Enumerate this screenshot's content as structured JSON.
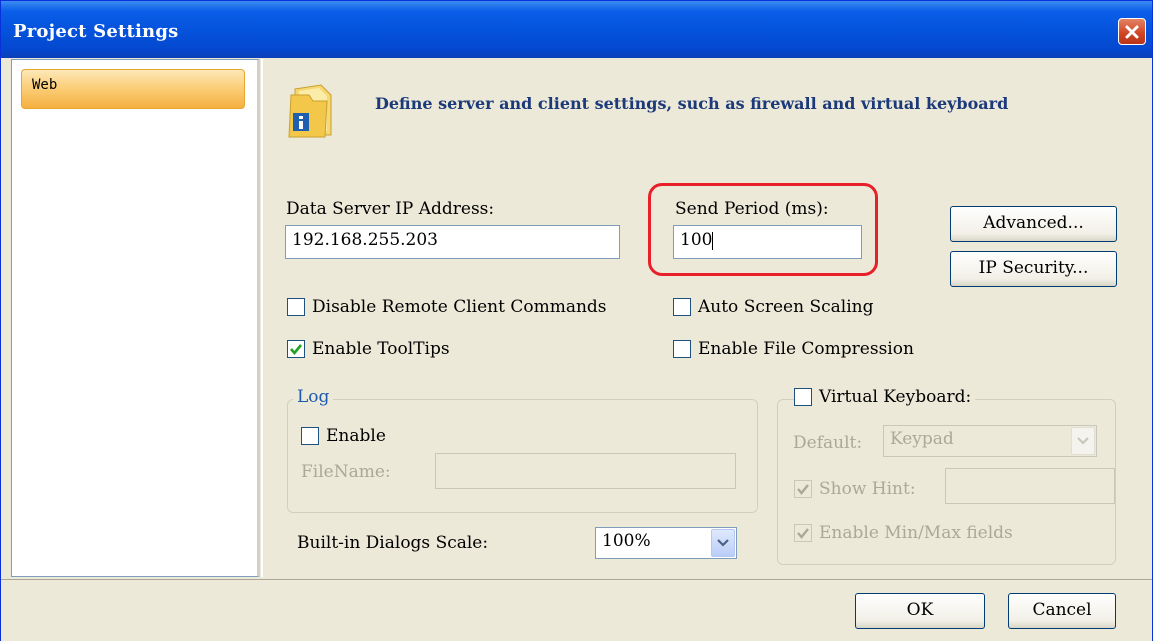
{
  "window": {
    "title": "Project Settings",
    "close_icon": "close-icon"
  },
  "sidebar": {
    "items": [
      {
        "label": "Web",
        "selected": true
      }
    ]
  },
  "banner": {
    "icon": "folder-info-icon",
    "text": "Define server and  client settings, such as firewall and virtual keyboard"
  },
  "fields": {
    "ip_label": "Data Server IP Address:",
    "ip_value": "192.168.255.203",
    "period_label": "Send Period (ms):",
    "period_value": "100"
  },
  "buttons": {
    "advanced": "Advanced...",
    "ip_security": "IP Security...",
    "ok": "OK",
    "cancel": "Cancel"
  },
  "checkboxes": {
    "disable_remote": {
      "label": "Disable Remote Client Commands",
      "checked": false
    },
    "enable_tooltips": {
      "label": "Enable ToolTips",
      "checked": true
    },
    "auto_scaling": {
      "label": "Auto Screen Scaling",
      "checked": false
    },
    "file_compression": {
      "label": "Enable File Compression",
      "checked": false
    }
  },
  "log": {
    "title": "Log",
    "enable_label": "Enable",
    "filename_label": "FileName:",
    "filename_value": ""
  },
  "virtual_keyboard": {
    "label": "Virtual Keyboard:",
    "default_label": "Default:",
    "default_value": "Keypad",
    "show_hint_label": "Show Hint:",
    "show_hint_value": "",
    "minmax_label": "Enable Min/Max fields"
  },
  "scale": {
    "label": "Built-in Dialogs Scale:",
    "value": "100%"
  },
  "colors": {
    "title_bar": "#0553dd",
    "highlight": "#e8202a",
    "selected_item": "#fbcf7a"
  }
}
